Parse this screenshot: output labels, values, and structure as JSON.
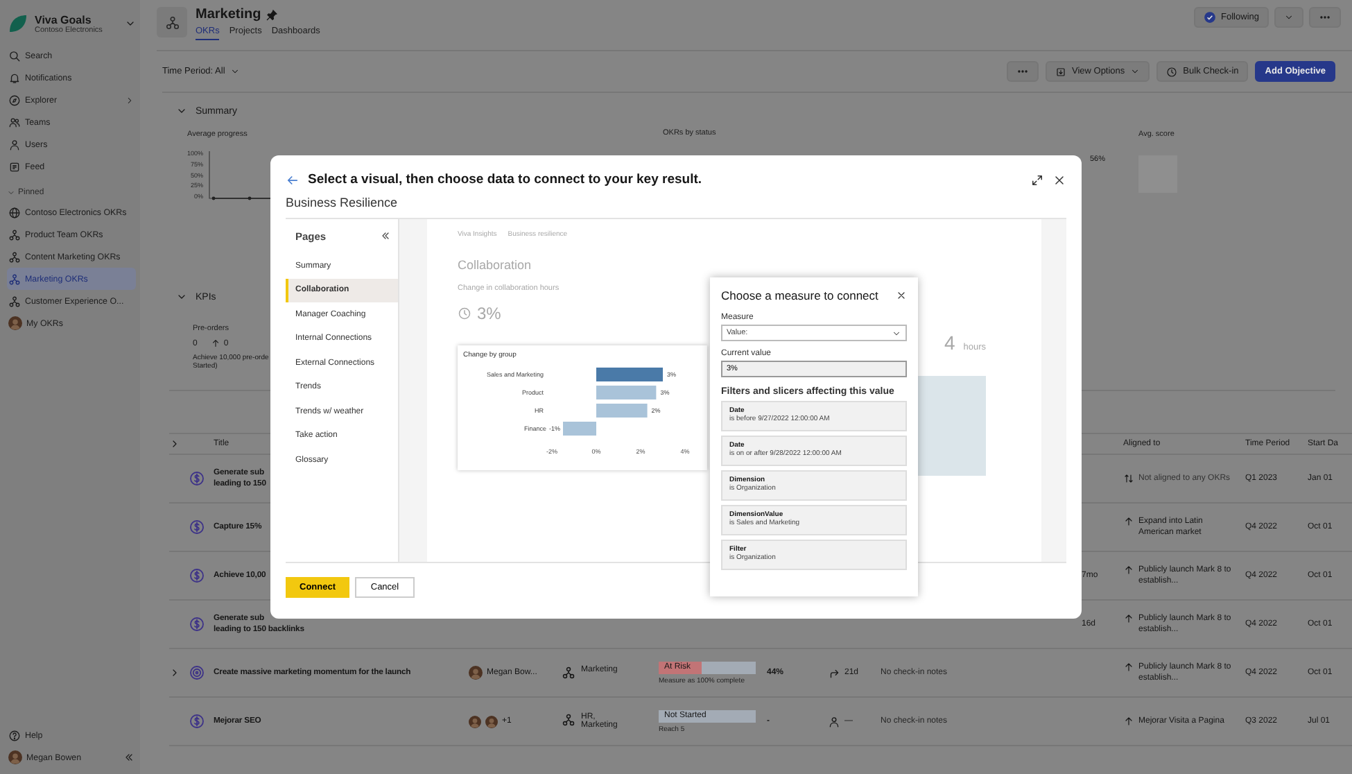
{
  "sidebar": {
    "app_name": "Viva Goals",
    "org": "Contoso Electronics",
    "nav": [
      {
        "label": "Search",
        "expandable": false
      },
      {
        "label": "Notifications",
        "expandable": false
      },
      {
        "label": "Explorer",
        "expandable": true
      },
      {
        "label": "Teams",
        "expandable": false
      },
      {
        "label": "Users",
        "expandable": false
      },
      {
        "label": "Feed",
        "expandable": false
      }
    ],
    "pinned_label": "Pinned",
    "pinned": [
      {
        "label": "Contoso Electronics OKRs",
        "selected": false
      },
      {
        "label": "Product Team OKRs",
        "selected": false
      },
      {
        "label": "Content Marketing OKRs",
        "selected": false
      },
      {
        "label": "Marketing OKRs",
        "selected": true
      },
      {
        "label": "Customer Experience O...",
        "selected": false
      },
      {
        "label": "My OKRs",
        "selected": false
      }
    ],
    "help": "Help",
    "user": "Megan Bowen"
  },
  "header": {
    "title": "Marketing",
    "tabs": [
      {
        "label": "OKRs",
        "selected": true
      },
      {
        "label": "Projects",
        "selected": false
      },
      {
        "label": "Dashboards",
        "selected": false
      }
    ],
    "follow_button": "Following"
  },
  "toolbar": {
    "time_period": "Time Period: All",
    "view_options": "View Options",
    "bulk_checkin": "Bulk Check-in",
    "add_objective": "Add Objective"
  },
  "summary": {
    "heading": "Summary",
    "average_progress": "Average progress",
    "progress_ticks": [
      "100%",
      "75%",
      "50%",
      "25%",
      "0%"
    ],
    "okrs_by_status": "OKRs by status",
    "status_reading": "56%",
    "avg_score": "Avg. score"
  },
  "kpis": {
    "heading": "KPIs",
    "name": "Pre-orders",
    "value": "0",
    "change": "0",
    "description_lines": [
      "Achieve 10,000 pre-orde",
      "Started)"
    ]
  },
  "table": {
    "columns": [
      "Title",
      "Aligned to",
      "Time Period",
      "Start Da"
    ],
    "rows": [
      {
        "kind": "key_result",
        "expandable": false,
        "title_lines": [
          "Generate sub",
          "leading to 150"
        ],
        "aligned": {
          "kind": "none",
          "text": "Not aligned to any OKRs"
        },
        "period": "Q1 2023",
        "start": "Jan 01"
      },
      {
        "kind": "key_result",
        "expandable": false,
        "title_lines": [
          "Capture 15%"
        ],
        "aligned": {
          "kind": "up",
          "text": "Expand into Latin American market"
        },
        "period": "Q4 2022",
        "start": "Oct 01"
      },
      {
        "kind": "key_result",
        "expandable": false,
        "title_lines": [
          "Achieve 10,00"
        ],
        "age": "7mo",
        "aligned": {
          "kind": "up",
          "text": "Publicly launch Mark 8 to establish..."
        },
        "period": "Q4 2022",
        "start": "Oct 01"
      },
      {
        "kind": "key_result",
        "expandable": false,
        "title_lines": [
          "Generate sub",
          "leading to 150 backlinks"
        ],
        "age": "16d",
        "aligned": {
          "kind": "up",
          "text": "Publicly launch Mark 8 to establish..."
        },
        "period": "Q4 2022",
        "start": "Oct 01"
      },
      {
        "kind": "objective",
        "expandable": true,
        "title_lines": [
          "Create massive marketing momentum for the launch"
        ],
        "owner": {
          "kind": "single",
          "name": "Megan Bow..."
        },
        "team": "Marketing",
        "status": {
          "label": "At Risk",
          "color": "#c27476",
          "level": 0.44
        },
        "progress": "44%",
        "status_note": "Measure as 100% complete",
        "checkin": {
          "kind": "trend",
          "text": "21d"
        },
        "notes": "No check-in notes",
        "aligned": {
          "kind": "up",
          "text": "Publicly launch Mark 8 to establish..."
        },
        "period": "Q4 2022",
        "start": "Oct 01"
      },
      {
        "kind": "key_result",
        "expandable": false,
        "title_lines": [
          "Mejorar SEO"
        ],
        "owner": {
          "kind": "group",
          "more": "+1"
        },
        "team": "HR, Marketing",
        "status": {
          "label": "Not Started"
        },
        "progress": "-",
        "status_note": "Reach 5",
        "checkin": {
          "kind": "person",
          "text": "—"
        },
        "notes": "No check-in notes",
        "aligned": {
          "kind": "up",
          "text": "Mejorar Visita a Pagina"
        },
        "period": "Q3 2022",
        "start": "Jul 01"
      }
    ]
  },
  "modal": {
    "title": "Select a visual, then choose data to connect to your key result.",
    "subtitle": "Business Resilience",
    "pages_heading": "Pages",
    "pages": [
      {
        "label": "Summary",
        "selected": false
      },
      {
        "label": "Collaboration",
        "selected": true
      },
      {
        "label": "Manager Coaching",
        "selected": false
      },
      {
        "label": "Internal Connections",
        "selected": false
      },
      {
        "label": "External Connections",
        "selected": false
      },
      {
        "label": "Trends",
        "selected": false
      },
      {
        "label": "Trends w/ weather",
        "selected": false
      },
      {
        "label": "Take action",
        "selected": false
      },
      {
        "label": "Glossary",
        "selected": false
      }
    ],
    "report": {
      "app": "Viva Insights",
      "section": "Business resilience",
      "page_title": "Collaboration",
      "card_title": "Change in collaboration hours",
      "card_value": "3%",
      "side_value": "4",
      "side_unit": "hours",
      "chart": {
        "bars_selected": [
          true,
          false,
          false,
          false
        ],
        "chart_data": {
          "type": "bar",
          "orientation": "horizontal",
          "title": "Change by group",
          "categories": [
            "Sales and Marketing",
            "Product",
            "HR",
            "Finance"
          ],
          "values": [
            3,
            2.7,
            2.3,
            -1.5
          ],
          "xlim": [
            -2,
            4
          ],
          "xticks": [
            {
              "value": -2,
              "label": "-2%"
            },
            {
              "value": 0,
              "label": "0%"
            },
            {
              "value": 2,
              "label": "2%"
            },
            {
              "value": 4,
              "label": "4%"
            }
          ],
          "value_labels": [
            "3%",
            "3%",
            "2%",
            "-1%"
          ]
        }
      }
    },
    "measure_panel": {
      "title": "Choose a measure to connect",
      "measure_label": "Measure",
      "measure_value": "Value:",
      "current_label": "Current value",
      "current_value": "3%",
      "filters_heading": "Filters and slicers affecting this value",
      "filters": [
        {
          "name": "Date",
          "condition": "is before 9/27/2022 12:00:00 AM"
        },
        {
          "name": "Date",
          "condition": "is on or after 9/28/2022 12:00:00 AM"
        },
        {
          "name": "Dimension",
          "condition": "is Organization"
        },
        {
          "name": "DimensionValue",
          "condition": "is Sales and Marketing"
        },
        {
          "name": "Filter",
          "condition": "is Organization"
        }
      ]
    },
    "connect": "Connect",
    "cancel": "Cancel"
  }
}
